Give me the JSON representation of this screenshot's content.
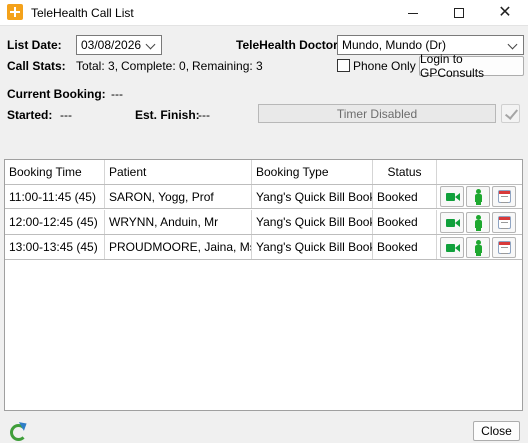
{
  "window": {
    "title": "TeleHealth Call List"
  },
  "list_date": {
    "label": "List Date:",
    "value": "03/08/2026"
  },
  "doctor": {
    "label": "TeleHealth Doctor:",
    "value": "Mundo, Mundo (Dr)"
  },
  "call_stats": {
    "label": "Call Stats:",
    "total": "Total: 3,",
    "complete": "Complete: 0,",
    "remaining": "Remaining: 3"
  },
  "phone_only": {
    "label": "Phone Only",
    "checked": false
  },
  "login_button": {
    "label": "Login to GPConsults"
  },
  "current_booking": {
    "label": "Current Booking:",
    "value": "---"
  },
  "started": {
    "label": "Started:",
    "value": "---"
  },
  "est_finish": {
    "label": "Est. Finish:",
    "value": "---"
  },
  "timer": {
    "label": "Timer Disabled"
  },
  "table": {
    "columns": [
      "Booking Time",
      "Patient",
      "Booking Type",
      "Status"
    ],
    "rows": [
      {
        "time": "11:00-11:45 (45)",
        "patient": "SARON, Yogg, Prof",
        "type": "Yang's Quick Bill Booki...",
        "status": "Booked"
      },
      {
        "time": "12:00-12:45 (45)",
        "patient": "WRYNN, Anduin, Mr",
        "type": "Yang's Quick Bill Booki...",
        "status": "Booked"
      },
      {
        "time": "13:00-13:45 (45)",
        "patient": "PROUDMOORE, Jaina, Ms",
        "type": "Yang's Quick Bill Booki...",
        "status": "Booked"
      }
    ]
  },
  "close_button": {
    "label": "Close"
  },
  "icons": {
    "app": "telehealth-app-icon",
    "video_call": "video-camera-icon",
    "patient": "person-icon",
    "calendar": "calendar-icon",
    "refresh": "refresh-icon"
  },
  "colors": {
    "accent_orange": "#f4a21b",
    "icon_green": "#10a03b",
    "calendar_red": "#d83a3a"
  }
}
